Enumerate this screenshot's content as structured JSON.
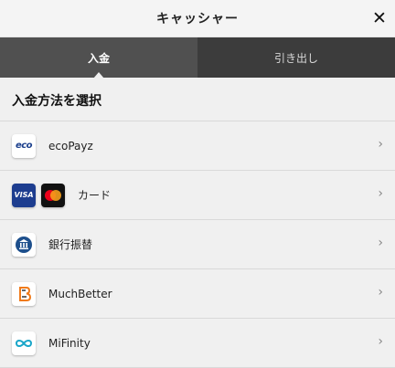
{
  "header": {
    "title": "キャッシャー",
    "close_label": "✕"
  },
  "tabs": [
    {
      "label": "入金",
      "active": true
    },
    {
      "label": "引き出し",
      "active": false
    }
  ],
  "section": {
    "title": "入金方法を選択"
  },
  "methods": [
    {
      "label": "ecoPayz",
      "logo_text": "eco"
    },
    {
      "label": "カード",
      "logo_text": "VISA"
    },
    {
      "label": "銀行振替"
    },
    {
      "label": "MuchBetter"
    },
    {
      "label": "MiFinity"
    }
  ],
  "icons": {
    "chevron": "›"
  },
  "colors": {
    "tab_bar": "#3c3c3c",
    "tab_active": "#505050",
    "background": "#f0f0f0"
  }
}
